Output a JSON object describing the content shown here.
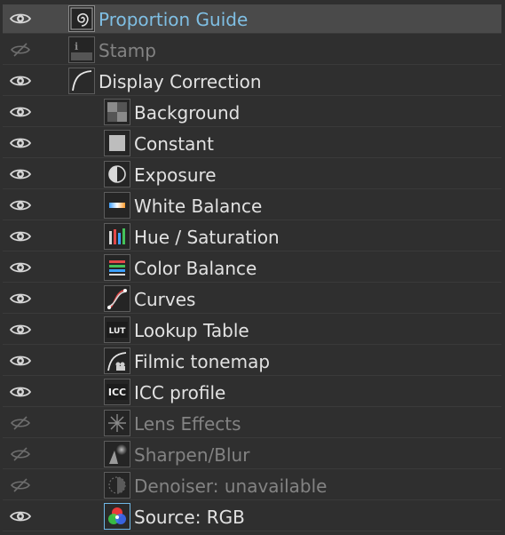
{
  "colors": {
    "background": "#2f2f2f",
    "selected_row": "#4a4a4a",
    "active_text": "#7fbfe4",
    "text": "#e2e2e2",
    "disabled_text": "#838383"
  },
  "layers": [
    {
      "label": "Proportion Guide",
      "visible": true,
      "selected": true,
      "icon": "spiral-icon",
      "indent": 0,
      "state": "active"
    },
    {
      "label": "Stamp",
      "visible": false,
      "selected": false,
      "icon": "info-stamp-icon",
      "indent": 0,
      "state": "disabled"
    },
    {
      "label": "Display Correction",
      "visible": true,
      "selected": false,
      "icon": "curve-icon",
      "indent": 0,
      "state": "normal"
    },
    {
      "label": "Background",
      "visible": true,
      "selected": false,
      "icon": "checker-icon",
      "indent": 1,
      "state": "normal"
    },
    {
      "label": "Constant",
      "visible": true,
      "selected": false,
      "icon": "square-icon",
      "indent": 1,
      "state": "normal"
    },
    {
      "label": "Exposure",
      "visible": true,
      "selected": false,
      "icon": "exposure-icon",
      "indent": 1,
      "state": "normal"
    },
    {
      "label": "White Balance",
      "visible": true,
      "selected": false,
      "icon": "white-balance-icon",
      "indent": 1,
      "state": "normal"
    },
    {
      "label": "Hue / Saturation",
      "visible": true,
      "selected": false,
      "icon": "hue-saturation-icon",
      "indent": 1,
      "state": "normal"
    },
    {
      "label": "Color Balance",
      "visible": true,
      "selected": false,
      "icon": "color-balance-icon",
      "indent": 1,
      "state": "normal"
    },
    {
      "label": "Curves",
      "visible": true,
      "selected": false,
      "icon": "curves-icon",
      "indent": 1,
      "state": "normal"
    },
    {
      "label": "Lookup Table",
      "visible": true,
      "selected": false,
      "icon": "lut-icon",
      "icon_text": "LUT",
      "indent": 1,
      "state": "normal"
    },
    {
      "label": "Filmic tonemap",
      "visible": true,
      "selected": false,
      "icon": "filmic-icon",
      "indent": 1,
      "state": "normal"
    },
    {
      "label": "ICC profile",
      "visible": true,
      "selected": false,
      "icon": "icc-icon",
      "icon_text": "ICC",
      "indent": 1,
      "state": "normal"
    },
    {
      "label": "Lens Effects",
      "visible": false,
      "selected": false,
      "icon": "lens-effects-icon",
      "indent": 1,
      "state": "disabled"
    },
    {
      "label": "Sharpen/Blur",
      "visible": false,
      "selected": false,
      "icon": "sharpen-blur-icon",
      "indent": 1,
      "state": "disabled"
    },
    {
      "label": "Denoiser: unavailable",
      "visible": false,
      "selected": false,
      "icon": "denoiser-icon",
      "indent": 1,
      "state": "disabled"
    },
    {
      "label": "Source: RGB",
      "visible": true,
      "selected": false,
      "icon": "rgb-source-icon",
      "indent": 1,
      "state": "normal"
    }
  ]
}
